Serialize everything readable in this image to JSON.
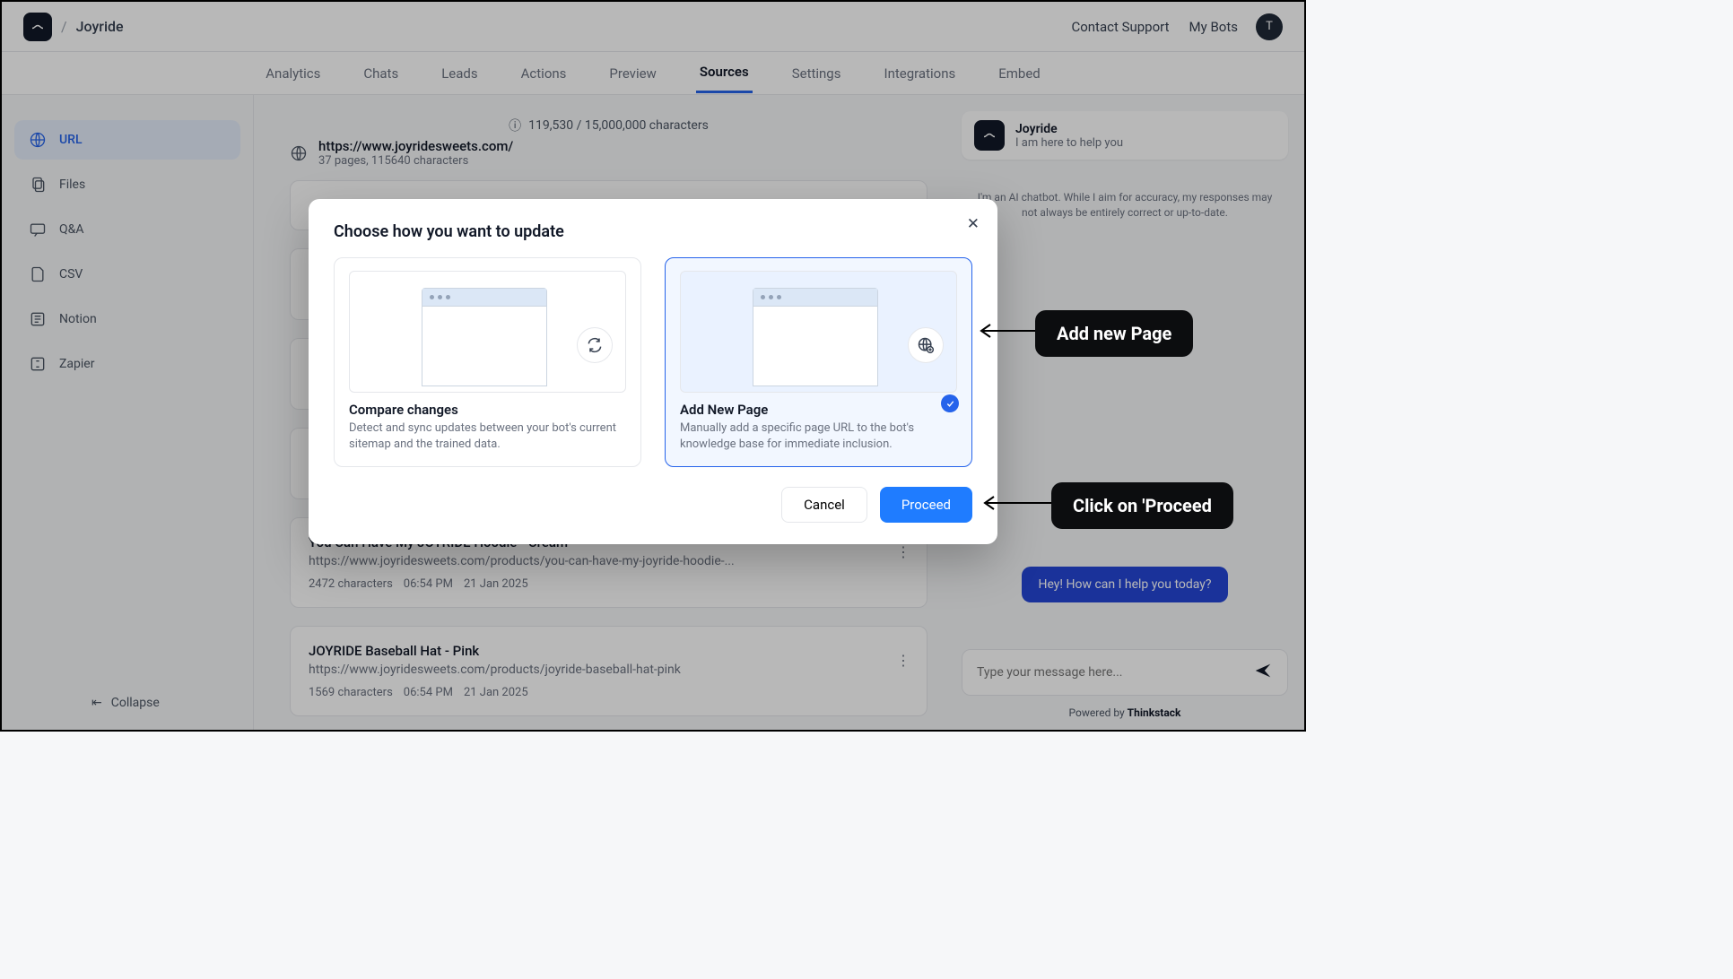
{
  "header": {
    "breadcrumb": "Joyride",
    "contact": "Contact Support",
    "mybots": "My Bots",
    "avatar_initial": "T"
  },
  "tabs": [
    "Analytics",
    "Chats",
    "Leads",
    "Actions",
    "Preview",
    "Sources",
    "Settings",
    "Integrations",
    "Embed"
  ],
  "active_tab_index": 5,
  "sidebar": {
    "items": [
      {
        "label": "URL"
      },
      {
        "label": "Files"
      },
      {
        "label": "Q&A"
      },
      {
        "label": "CSV"
      },
      {
        "label": "Notion"
      },
      {
        "label": "Zapier"
      }
    ],
    "collapse": "Collapse"
  },
  "source": {
    "char_count": "119,530 / 15,000,000 characters",
    "url": "https://www.joyridesweets.com/",
    "sub": "37 pages, 115640 characters"
  },
  "pages": [
    {
      "title": "You Can Have My JOYRIDE Hoodie - Cream",
      "url": "https://www.joyridesweets.com/products/you-can-have-my-joyride-hoodie-...",
      "chars": "2472 characters",
      "time": "06:54 PM",
      "date": "21 Jan 2025"
    },
    {
      "title": "JOYRIDE Baseball Hat - Pink",
      "url": "https://www.joyridesweets.com/products/joyride-baseball-hat-pink",
      "chars": "1569 characters",
      "time": "06:54 PM",
      "date": "21 Jan 2025"
    }
  ],
  "chat": {
    "name": "Joyride",
    "tagline": "I am here to help you",
    "disclaimer": "I'm an AI chatbot. While I aim for accuracy, my responses may not always be entirely correct or up-to-date.",
    "bubble": "Hey! How can I help you today?",
    "placeholder": "Type your message here...",
    "powered_prefix": "Powered by ",
    "powered_brand": "Thinkstack"
  },
  "modal": {
    "title": "Choose how you want to update",
    "options": [
      {
        "title": "Compare changes",
        "desc": "Detect and sync updates between your bot's current sitemap and the trained data."
      },
      {
        "title": "Add New Page",
        "desc": "Manually add a specific page URL to the bot's knowledge base for immediate inclusion."
      }
    ],
    "cancel": "Cancel",
    "proceed": "Proceed"
  },
  "annotations": {
    "add_page": "Add new Page",
    "click_proceed": "Click on 'Proceed"
  }
}
